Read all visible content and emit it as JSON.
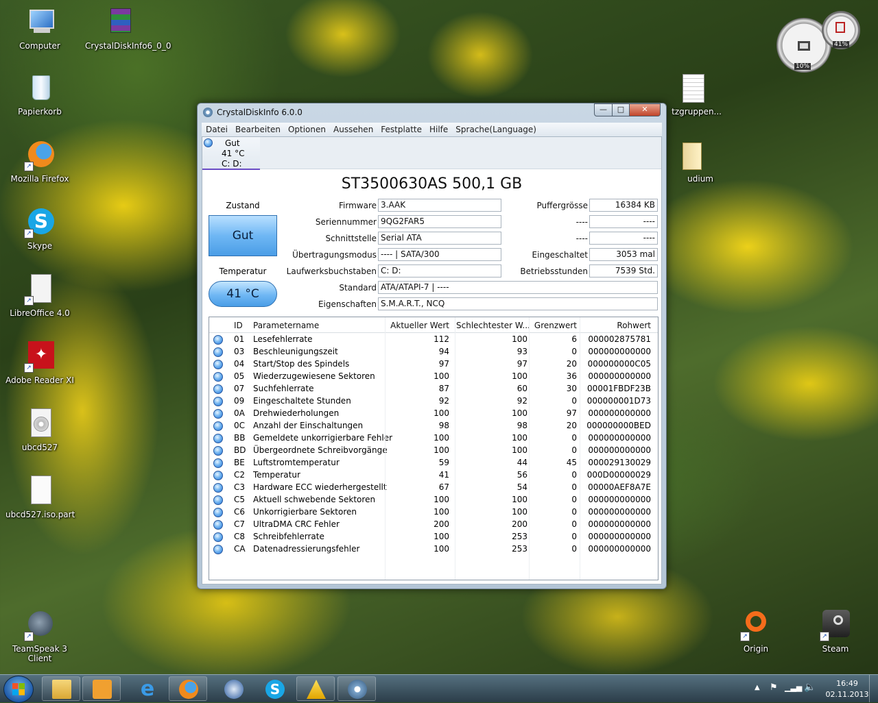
{
  "desktop": {
    "icons": [
      {
        "label": "Computer",
        "icon": "computer-icon"
      },
      {
        "label": "CrystalDiskInfo6_0_0",
        "icon": "archive-icon"
      },
      {
        "label": "Papierkorb",
        "icon": "recycle-bin-icon"
      },
      {
        "label": "Mozilla Firefox",
        "icon": "firefox-icon"
      },
      {
        "label": "Skype",
        "icon": "skype-icon"
      },
      {
        "label": "LibreOffice 4.0",
        "icon": "document-icon"
      },
      {
        "label": "Adobe Reader XI",
        "icon": "pdf-icon"
      },
      {
        "label": "ubcd527",
        "icon": "disc-icon"
      },
      {
        "label": "ubcd527.iso.part",
        "icon": "blank-file-icon"
      },
      {
        "label": "TeamSpeak 3 Client",
        "icon": "teamspeak-icon"
      },
      {
        "label": "Origin",
        "icon": "origin-icon"
      },
      {
        "label": "Steam",
        "icon": "steam-icon"
      },
      {
        "label": "tzgruppen...",
        "icon": "text-file-icon"
      },
      {
        "label": "udium",
        "icon": "folder-icon"
      }
    ],
    "gadget": {
      "cpu": "10%",
      "ram": "41%"
    }
  },
  "window": {
    "title": "CrystalDiskInfo 6.0.0",
    "controls": {
      "minimize": "—",
      "maximize": "□",
      "close": "✕"
    },
    "menu": [
      "Datei",
      "Bearbeiten",
      "Optionen",
      "Aussehen",
      "Festplatte",
      "Hilfe",
      "Sprache(Language)"
    ],
    "disk_tab": {
      "status": "Gut",
      "temp": "41 °C",
      "drives": "C: D:"
    },
    "model": "ST3500630AS 500,1 GB",
    "health": {
      "label": "Zustand",
      "value": "Gut"
    },
    "temperature": {
      "label": "Temperatur",
      "value": "41 °C"
    },
    "info_left": [
      {
        "label": "Firmware",
        "value": "3.AAK"
      },
      {
        "label": "Seriennummer",
        "value": "9QG2FAR5"
      },
      {
        "label": "Schnittstelle",
        "value": "Serial ATA"
      },
      {
        "label": "Übertragungsmodus",
        "value": "---- | SATA/300"
      },
      {
        "label": "Laufwerksbuchstaben",
        "value": "C: D:"
      }
    ],
    "info_right": [
      {
        "label": "Puffergrösse",
        "value": "16384 KB"
      },
      {
        "label": "----",
        "value": "----"
      },
      {
        "label": "----",
        "value": "----"
      },
      {
        "label": "Eingeschaltet",
        "value": "3053 mal"
      },
      {
        "label": "Betriebsstunden",
        "value": "7539 Std."
      }
    ],
    "standard": {
      "label": "Standard",
      "value": "ATA/ATAPI-7 | ----"
    },
    "features": {
      "label": "Eigenschaften",
      "value": "S.M.A.R.T., NCQ"
    },
    "smart": {
      "columns": [
        "ID",
        "Parametername",
        "Aktueller Wert",
        "Schlechtester W...",
        "Grenzwert",
        "Rohwert"
      ],
      "rows": [
        [
          "01",
          "Lesefehlerrate",
          "112",
          "100",
          "6",
          "000002875781"
        ],
        [
          "03",
          "Beschleunigungszeit",
          "94",
          "93",
          "0",
          "000000000000"
        ],
        [
          "04",
          "Start/Stop des Spindels",
          "97",
          "97",
          "20",
          "000000000C05"
        ],
        [
          "05",
          "Wiederzugewiesene Sektoren",
          "100",
          "100",
          "36",
          "000000000000"
        ],
        [
          "07",
          "Suchfehlerrate",
          "87",
          "60",
          "30",
          "00001FBDF23B"
        ],
        [
          "09",
          "Eingeschaltete Stunden",
          "92",
          "92",
          "0",
          "000000001D73"
        ],
        [
          "0A",
          "Drehwiederholungen",
          "100",
          "100",
          "97",
          "000000000000"
        ],
        [
          "0C",
          "Anzahl der Einschaltungen",
          "98",
          "98",
          "20",
          "000000000BED"
        ],
        [
          "BB",
          "Gemeldete unkorrigierbare Fehler",
          "100",
          "100",
          "0",
          "000000000000"
        ],
        [
          "BD",
          "Übergeordnete Schreibvorgänge",
          "100",
          "100",
          "0",
          "000000000000"
        ],
        [
          "BE",
          "Luftstromtemperatur",
          "59",
          "44",
          "45",
          "000029130029"
        ],
        [
          "C2",
          "Temperatur",
          "41",
          "56",
          "0",
          "000D00000029"
        ],
        [
          "C3",
          "Hardware ECC wiederhergestellt",
          "67",
          "54",
          "0",
          "00000AEF8A7E"
        ],
        [
          "C5",
          "Aktuell schwebende Sektoren",
          "100",
          "100",
          "0",
          "000000000000"
        ],
        [
          "C6",
          "Unkorrigierbare Sektoren",
          "100",
          "100",
          "0",
          "000000000000"
        ],
        [
          "C7",
          "UltraDMA CRC Fehler",
          "200",
          "200",
          "0",
          "000000000000"
        ],
        [
          "C8",
          "Schreibfehlerrate",
          "100",
          "253",
          "0",
          "000000000000"
        ],
        [
          "CA",
          "Datenadressierungsfehler",
          "100",
          "253",
          "0",
          "000000000000"
        ]
      ]
    }
  },
  "taskbar": {
    "buttons": [
      "explorer-icon",
      "media-player-icon",
      "internet-explorer-icon",
      "firefox-icon",
      "thunderbird-icon",
      "skype-icon",
      "action-center-icon",
      "crystaldiskinfo-icon"
    ],
    "clock": {
      "time": "16:49",
      "date": "02.11.2013"
    }
  }
}
